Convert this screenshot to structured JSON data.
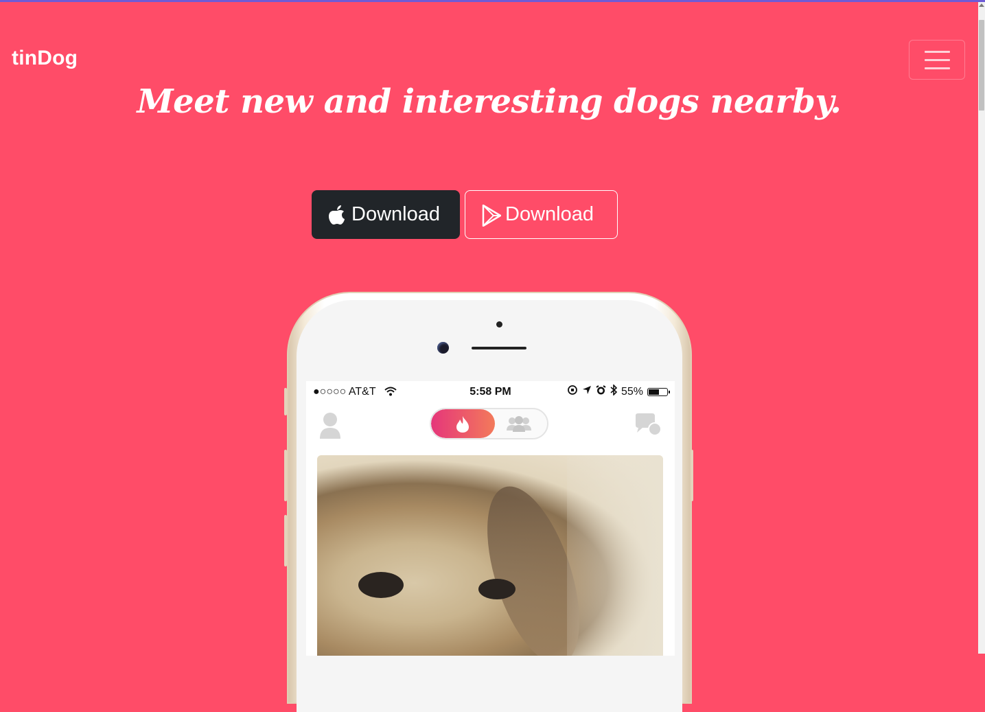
{
  "brand": {
    "name": "tinDog"
  },
  "nav": {
    "toggler_icon": "hamburger-menu-icon"
  },
  "hero": {
    "headline": "Meet new and interesting dogs nearby.",
    "buttons": [
      {
        "label": "Download",
        "icon": "apple-icon"
      },
      {
        "label": "Download",
        "icon": "google-play-icon"
      }
    ]
  },
  "phone": {
    "status_bar": {
      "carrier": "●○○○○ AT&T",
      "time": "5:58 PM",
      "battery": "55%"
    },
    "app": {
      "left_icon": "profile-icon",
      "segment_active": "flame-icon",
      "segment_inactive": "group-icon",
      "right_icon": "chat-icon"
    }
  },
  "colors": {
    "background": "#ff4c68",
    "apple_button": "#212529",
    "white": "#ffffff"
  }
}
